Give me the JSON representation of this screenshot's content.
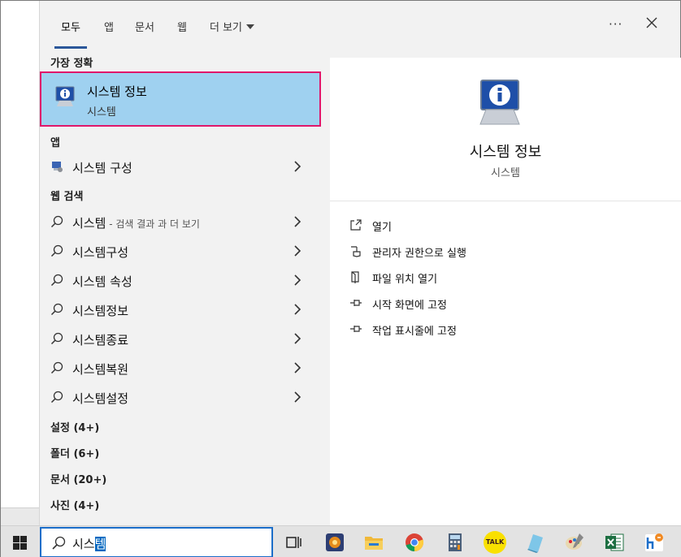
{
  "header": {
    "tabs": [
      {
        "label": "모두",
        "active": true
      },
      {
        "label": "앱"
      },
      {
        "label": "문서"
      },
      {
        "label": "웹"
      },
      {
        "label": "더 보기"
      }
    ],
    "more_icon": "ellipsis-icon",
    "close_icon": "close-icon"
  },
  "best_match": {
    "heading": "가장 정확",
    "title": "시스템 정보",
    "subtitle": "시스템",
    "icon": "system-info-icon"
  },
  "apps": {
    "heading": "앱",
    "items": [
      {
        "label": "시스템 구성",
        "icon": "system-config-icon"
      }
    ]
  },
  "web": {
    "heading": "웹 검색",
    "items": [
      {
        "label": "시스템",
        "hint": " - 검색 결과 과 더 보기"
      },
      {
        "label": "시스템구성"
      },
      {
        "label": "시스템 속성"
      },
      {
        "label": "시스템정보"
      },
      {
        "label": "시스템종료"
      },
      {
        "label": "시스템복원"
      },
      {
        "label": "시스템설정"
      }
    ]
  },
  "categories": [
    {
      "label": "설정 (4+)"
    },
    {
      "label": "폴더 (6+)"
    },
    {
      "label": "문서 (20+)"
    },
    {
      "label": "사진 (4+)"
    }
  ],
  "preview": {
    "title": "시스템 정보",
    "subtitle": "시스템",
    "actions": [
      {
        "label": "열기",
        "icon": "open-icon"
      },
      {
        "label": "관리자 권한으로 실행",
        "icon": "admin-shield-icon"
      },
      {
        "label": "파일 위치 열기",
        "icon": "file-location-icon"
      },
      {
        "label": "시작 화면에 고정",
        "icon": "pin-icon"
      },
      {
        "label": "작업 표시줄에 고정",
        "icon": "pin-icon"
      }
    ]
  },
  "taskbar": {
    "search_text_prefix": "시스",
    "search_text_selected": "템",
    "icons": [
      "windows-start-icon",
      "task-view-icon",
      "media-player-icon",
      "file-explorer-icon",
      "chrome-icon",
      "calculator-icon",
      "kakaotalk-icon",
      "notepad-icon",
      "paint-icon",
      "excel-icon",
      "hancom-icon"
    ],
    "kakaotalk_label": "TALK"
  },
  "colors": {
    "highlight": "#9fd1f0",
    "highlight_border": "#e0176b",
    "accent": "#1c6ec9"
  }
}
